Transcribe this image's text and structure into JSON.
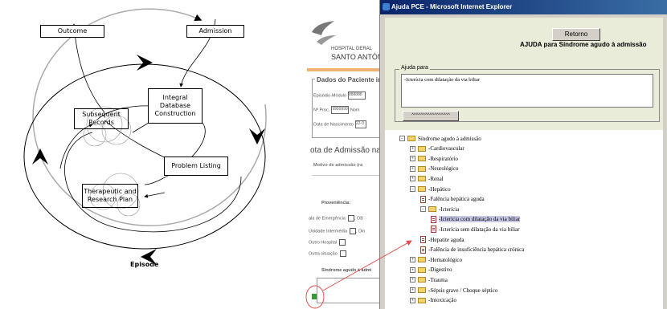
{
  "diagram": {
    "boxes": {
      "outcome": "Outcome",
      "admission": "Admission",
      "integral": "Integral Database Construction",
      "subsequent": "Subsequent Records",
      "problem": "Problem Listing",
      "therapeutic": "Therapeutic and Research Plan"
    },
    "caption": "Episode"
  },
  "app": {
    "hospital_line1": "HOSPITAL GERAL",
    "hospital_line2": "SANTO ANTÓN",
    "dados_title": "Dados do Paciente int",
    "fields": [
      {
        "label": "Episódio-Módulo",
        "value": "888888"
      },
      {
        "label": "Nº.Proc.",
        "value": "9999999",
        "extra": "Nom"
      },
      {
        "label": "Data de Nascimento",
        "value": "22-0"
      }
    ],
    "nota": "ota de Admissão na U",
    "motivo": "Motivo de admissão (ra",
    "proveniencia": "Proveniência:",
    "prov_options": [
      {
        "label": "ala de Emergência",
        "extra": ", OB"
      },
      {
        "label": "Unidade Intermédia",
        "extra": ", Din"
      },
      {
        "label": "Outro Hospital",
        "extra": ""
      },
      {
        "label": "Outra situação",
        "extra": ""
      }
    ],
    "sindrome": "Síndrome agudo à admi"
  },
  "ie": {
    "title": "Ajuda PCE - Microsoft Internet Explorer",
    "retorno": "Retorno",
    "heading": "AJUDA para Síndrome agudo à admissão",
    "legend": "Ajuda para",
    "textarea_value": "-Icterícia com dilatação da via biliar",
    "small_button": "^^^^^^^^^^^^^^^^^",
    "tree": [
      {
        "label": "Síndrome agudo à admissão",
        "kind": "folder",
        "toggle": "−",
        "level": 0
      },
      {
        "label": "-Cardiovascular",
        "kind": "folder",
        "toggle": "+",
        "level": 1
      },
      {
        "label": "-Respiratório",
        "kind": "folder",
        "toggle": "+",
        "level": 1
      },
      {
        "label": "-Neurológico",
        "kind": "folder",
        "toggle": "+",
        "level": 1
      },
      {
        "label": "-Renal",
        "kind": "folder",
        "toggle": "+",
        "level": 1
      },
      {
        "label": "-Hepático",
        "kind": "folder",
        "toggle": "−",
        "level": 1
      },
      {
        "label": "-Falência hepática aguda",
        "kind": "doc",
        "toggle": "",
        "level": 2
      },
      {
        "label": "-Icterícia",
        "kind": "folder",
        "toggle": "−",
        "level": 2
      },
      {
        "label": "-Icterícia com dilatação da via biliar",
        "kind": "doc",
        "toggle": "",
        "level": 3,
        "selected": true
      },
      {
        "label": "-Icterícia sem dilatação da via biliar",
        "kind": "doc",
        "toggle": "",
        "level": 3
      },
      {
        "label": "-Hepatite aguda",
        "kind": "doc",
        "toggle": "",
        "level": 2
      },
      {
        "label": "-Falência de insuficiência hepática crónica",
        "kind": "doc",
        "toggle": "",
        "level": 2
      },
      {
        "label": "-Hematológico",
        "kind": "folder",
        "toggle": "+",
        "level": 1
      },
      {
        "label": "-Digestivo",
        "kind": "folder",
        "toggle": "+",
        "level": 1
      },
      {
        "label": "-Trauma",
        "kind": "folder",
        "toggle": "+",
        "level": 1
      },
      {
        "label": "-Sépsis grave / Choque séptico",
        "kind": "folder",
        "toggle": "+",
        "level": 1
      },
      {
        "label": "-Intoxicação",
        "kind": "folder",
        "toggle": "+",
        "level": 1
      }
    ]
  },
  "colors": {
    "titlebar": "#0a246a",
    "panel": "#e8ecd8",
    "annotation": "#e05050"
  }
}
